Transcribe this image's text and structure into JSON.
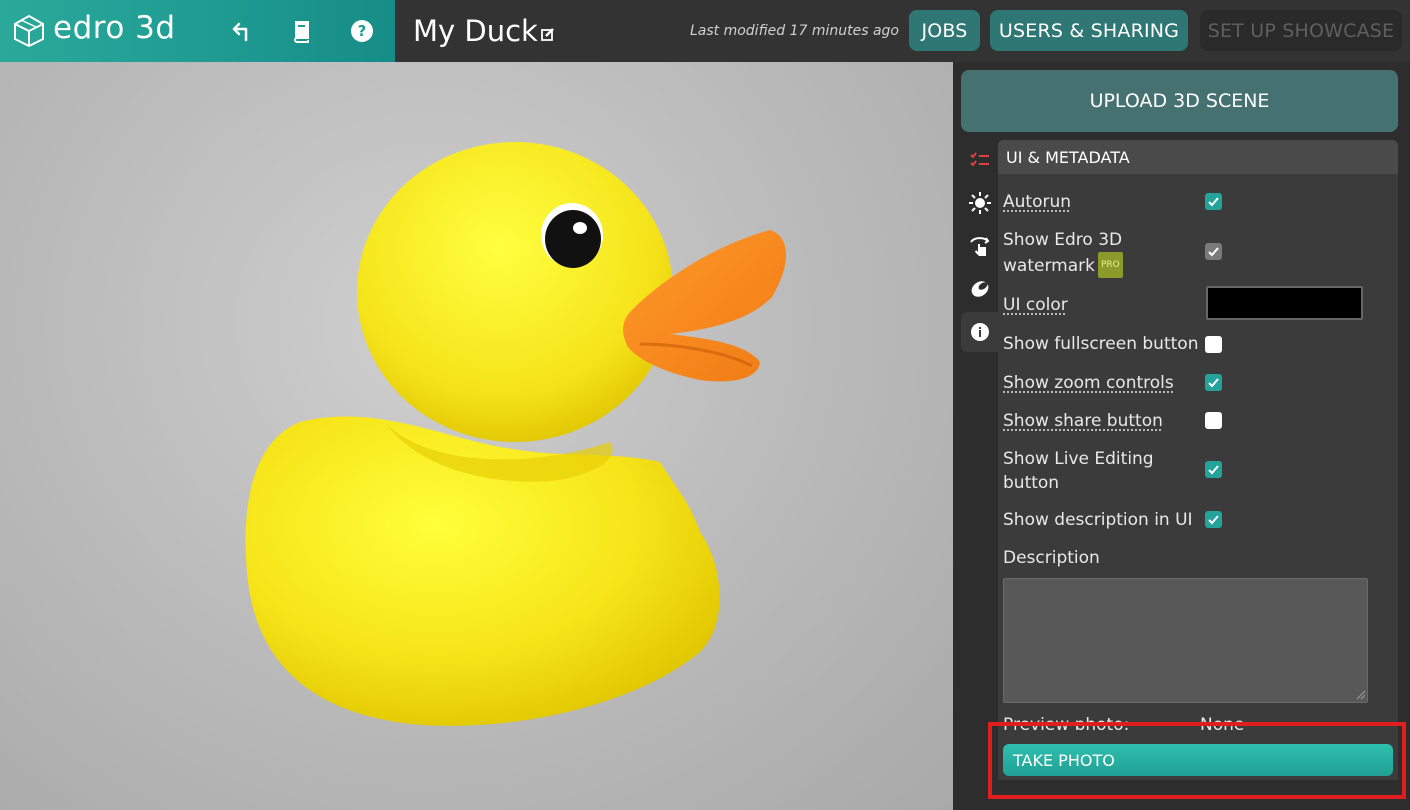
{
  "app": {
    "brand_name": "edro 3d",
    "brand_gradient": [
      "#2aa99a",
      "#168c86"
    ],
    "icons": [
      "logo-cube-icon",
      "back-arrow-icon",
      "book-icon",
      "help-icon",
      "edit-icon"
    ]
  },
  "header": {
    "title": "My Duck",
    "last_modified": "Last modified 17 minutes ago",
    "jobs_label": "JOBS",
    "users_sharing_label": "USERS & SHARING",
    "showcase_label": "SET UP SHOWCASE"
  },
  "panel": {
    "upload_label": "UPLOAD 3D SCENE",
    "side_icons": [
      "checklist-icon",
      "sun-icon",
      "hand-rotate-icon",
      "material-icon",
      "info-icon"
    ],
    "section_title": "UI & METADATA",
    "options": [
      {
        "label": "Autorun",
        "checked": true
      },
      {
        "label_line1": "Show Edro 3D",
        "label_line2": "watermark",
        "badge": "PRO",
        "checked": true
      },
      {
        "label": "UI color",
        "value": "#000000"
      },
      {
        "label": "Show fullscreen button",
        "checked": false
      },
      {
        "label": "Show zoom controls",
        "checked": true
      },
      {
        "label": "Show share button",
        "checked": false
      },
      {
        "label_line1": "Show Live Editing",
        "label_line2": "button",
        "checked": true
      },
      {
        "label": "Show description in UI",
        "checked": true
      }
    ],
    "description_label": "Description",
    "description_value": "",
    "preview_label": "Preview photo:",
    "preview_value": "None",
    "take_photo_label": "TAKE PHOTO",
    "accent_color": "#24a39a",
    "highlight_color": "#e01e1e"
  }
}
